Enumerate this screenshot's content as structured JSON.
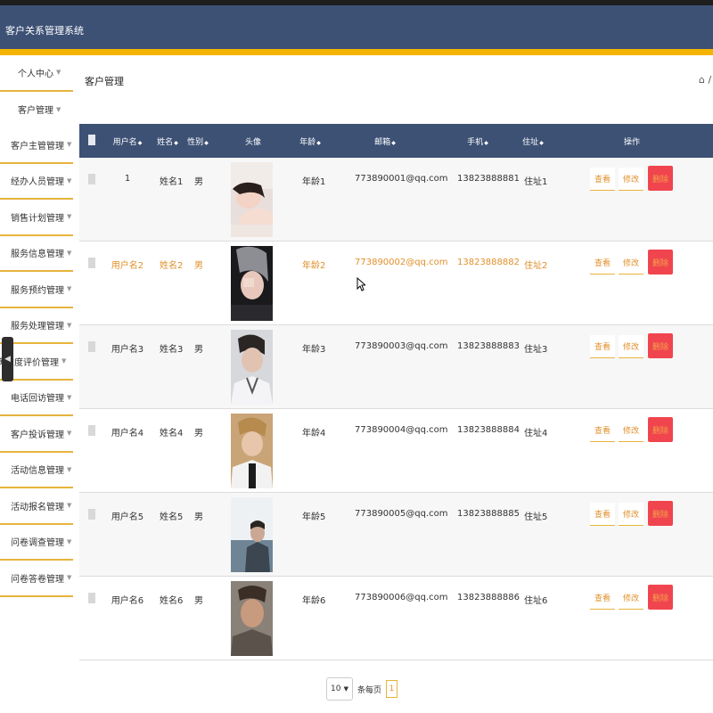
{
  "app": {
    "title": "客户关系管理系统"
  },
  "sidebar": {
    "items": [
      {
        "label": "个人中心"
      },
      {
        "label": "客户管理"
      },
      {
        "label": "客户主管管理"
      },
      {
        "label": "经办人员管理"
      },
      {
        "label": "销售计划管理"
      },
      {
        "label": "服务信息管理"
      },
      {
        "label": "服务预约管理"
      },
      {
        "label": "服务处理管理"
      },
      {
        "label": "满意度评价管理"
      },
      {
        "label": "电话回访管理"
      },
      {
        "label": "客户投诉管理"
      },
      {
        "label": "活动信息管理"
      },
      {
        "label": "活动报名管理"
      },
      {
        "label": "问卷调查管理"
      },
      {
        "label": "问卷答卷管理"
      }
    ],
    "collapse_icon": "chevron-left-icon"
  },
  "main": {
    "page_title": "客户管理",
    "breadcrumb": "⌂ /",
    "table": {
      "headers": {
        "username": "用户名",
        "name": "姓名",
        "gender": "性别",
        "avatar": "头像",
        "age": "年龄",
        "email": "邮箱",
        "phone": "手机",
        "address": "住址",
        "actions": "操作"
      },
      "rows": [
        {
          "username": "1",
          "name": "姓名1",
          "gender": "男",
          "age": "年龄1",
          "email": "773890001@qq.com",
          "phone": "13823888881",
          "address": "住址1",
          "highlighted": false
        },
        {
          "username": "用户名2",
          "name": "姓名2",
          "gender": "男",
          "age": "年龄2",
          "email": "773890002@qq.com",
          "phone": "13823888882",
          "address": "住址2",
          "highlighted": true
        },
        {
          "username": "用户名3",
          "name": "姓名3",
          "gender": "男",
          "age": "年龄3",
          "email": "773890003@qq.com",
          "phone": "13823888883",
          "address": "住址3",
          "highlighted": false
        },
        {
          "username": "用户名4",
          "name": "姓名4",
          "gender": "男",
          "age": "年龄4",
          "email": "773890004@qq.com",
          "phone": "13823888884",
          "address": "住址4",
          "highlighted": false
        },
        {
          "username": "用户名5",
          "name": "姓名5",
          "gender": "男",
          "age": "年龄5",
          "email": "773890005@qq.com",
          "phone": "13823888885",
          "address": "住址5",
          "highlighted": false
        },
        {
          "username": "用户名6",
          "name": "姓名6",
          "gender": "男",
          "age": "年龄6",
          "email": "773890006@qq.com",
          "phone": "13823888886",
          "address": "住址6",
          "highlighted": false
        }
      ],
      "buttons": {
        "view": "查看",
        "edit": "修改",
        "delete": "删除"
      }
    },
    "pagination": {
      "page_size": "10",
      "per_page_label": "条每页",
      "current_page": "1"
    }
  },
  "colors": {
    "header_bg": "#3d5175",
    "accent": "#f5b400",
    "link": "#e0902b",
    "delete_bg": "#f0454e"
  }
}
